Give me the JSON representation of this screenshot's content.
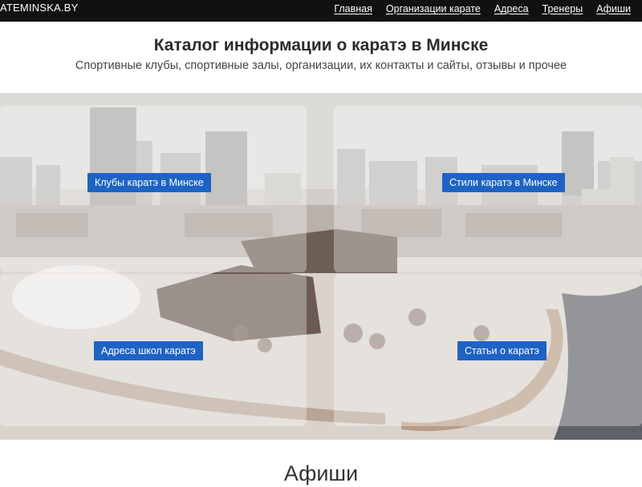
{
  "navbar": {
    "brand": "ATEMINSKA.BY",
    "links": [
      {
        "label": "Главная"
      },
      {
        "label": "Организации карате"
      },
      {
        "label": "Адреса"
      },
      {
        "label": "Тренеры"
      },
      {
        "label": "Афиши"
      }
    ]
  },
  "hero": {
    "title": "Каталог информации о каратэ в Минске",
    "subtitle": "Спортивные клубы, спортивные залы, организации, их контакты и сайты, отзывы и прочее"
  },
  "tiles": [
    {
      "label": "Клубы каратэ в Минске"
    },
    {
      "label": "Стили каратэ в Минске"
    },
    {
      "label": "Адреса школ каратэ"
    },
    {
      "label": "Статьи о каратэ"
    }
  ],
  "sections": {
    "afisha_title": "Афиши"
  },
  "colors": {
    "navbar": "#111111",
    "button": "#1e63c4"
  }
}
